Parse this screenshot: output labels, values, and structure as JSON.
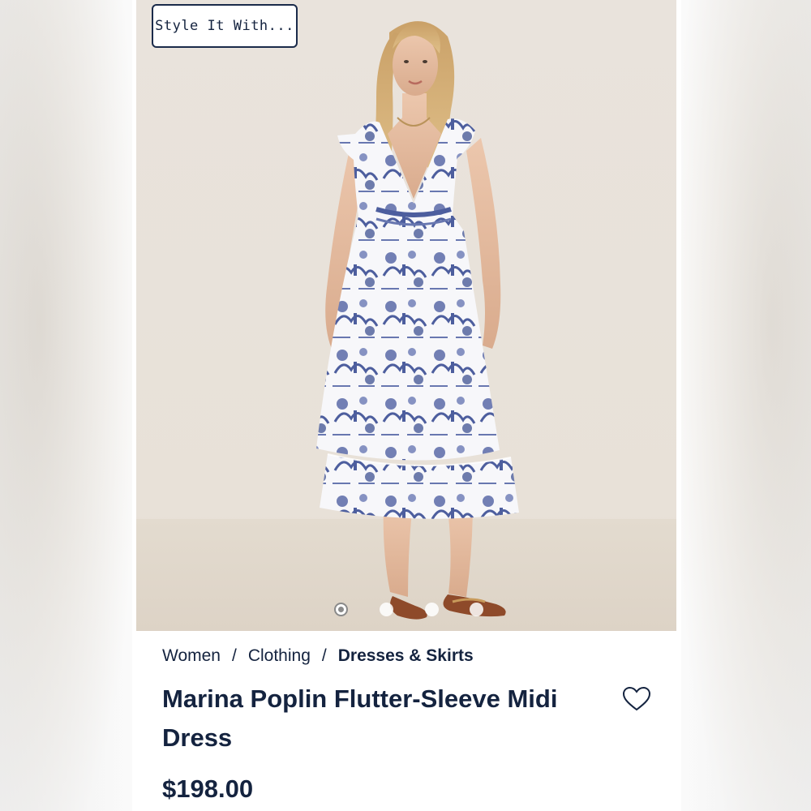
{
  "style_button": {
    "label": "Style It With..."
  },
  "carousel": {
    "total": 4,
    "active": 1
  },
  "breadcrumb": {
    "items": [
      {
        "label": "Women"
      },
      {
        "label": "Clothing"
      },
      {
        "label": "Dresses & Skirts"
      }
    ],
    "separator": "/"
  },
  "product": {
    "title": "Marina Poplin Flutter-Sleeve Midi Dress",
    "price": "$198.00",
    "wishlist_icon": "heart-outline-icon"
  },
  "colors": {
    "text": "#14233f",
    "print_blue": "#5a6aa8",
    "background": "#e9e3dc"
  }
}
